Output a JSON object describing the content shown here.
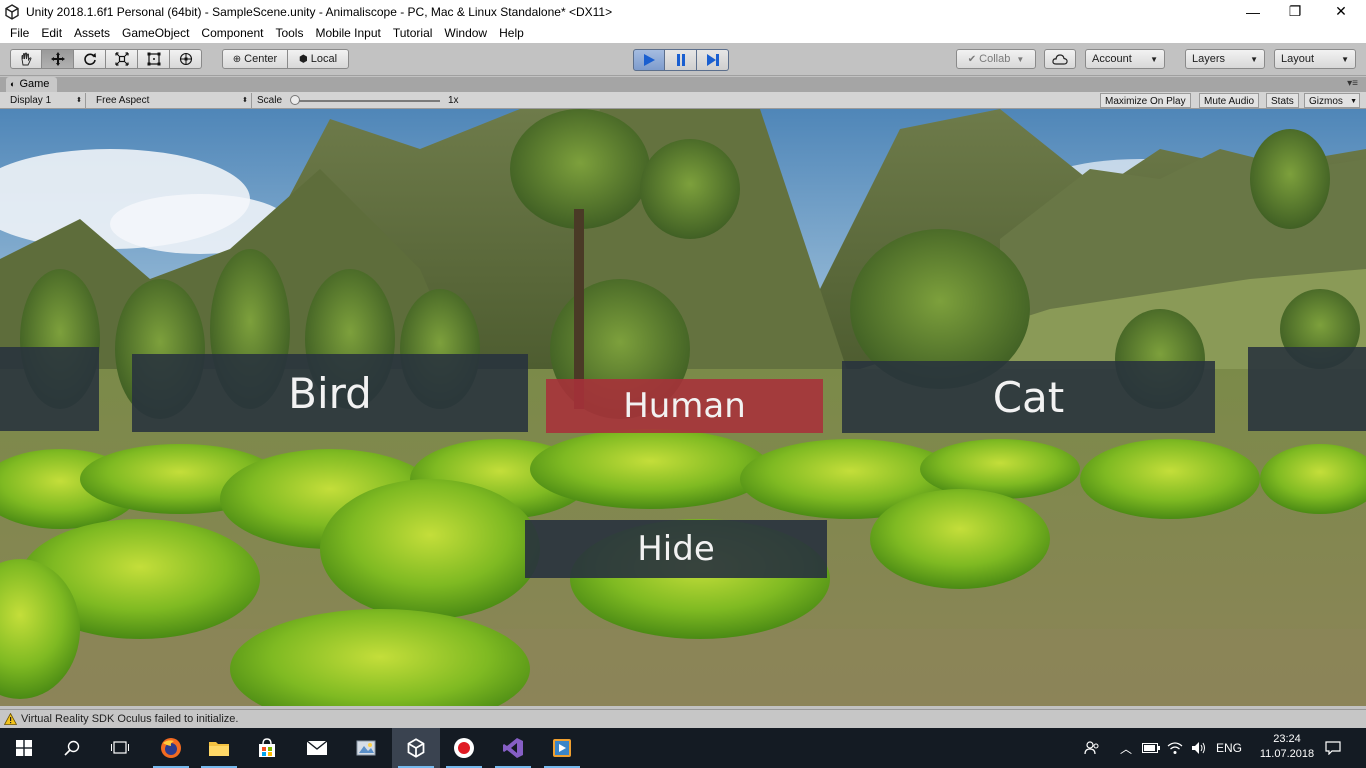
{
  "window": {
    "title": "Unity 2018.1.6f1 Personal (64bit) - SampleScene.unity - Animaliscope - PC, Mac & Linux Standalone* <DX11>",
    "controls": {
      "minimize": "—",
      "restore": "❐",
      "close": "✕"
    }
  },
  "menu": [
    "File",
    "Edit",
    "Assets",
    "GameObject",
    "Component",
    "Tools",
    "Mobile Input",
    "Tutorial",
    "Window",
    "Help"
  ],
  "toolbar": {
    "tools": [
      "hand-tool",
      "move-tool",
      "rotate-tool",
      "scale-tool",
      "rect-tool",
      "transform-tool"
    ],
    "active_tool": "move-tool",
    "pivot": "Center",
    "space": "Local",
    "collab": "Collab",
    "account": "Account",
    "layers": "Layers",
    "layout": "Layout"
  },
  "game_tab": {
    "label": "Game",
    "display": "Display 1",
    "aspect": "Free Aspect",
    "scale_label": "Scale",
    "scale_value": "1x",
    "maximize": "Maximize On Play",
    "mute": "Mute Audio",
    "stats": "Stats",
    "gizmos": "Gizmos"
  },
  "game_ui": {
    "options": [
      "Bird",
      "Human",
      "Cat"
    ],
    "selected": "Human",
    "hide_label": "Hide"
  },
  "status": {
    "message": "Virtual Reality SDK Oculus failed to initialize."
  },
  "taskbar": {
    "language": "ENG",
    "time": "23:24",
    "date": "11.07.2018"
  },
  "colors": {
    "play_active": "#7e9ccd",
    "panel_dark": "#2a3540",
    "panel_selected": "#a8303a",
    "taskbar": "#141b23"
  }
}
